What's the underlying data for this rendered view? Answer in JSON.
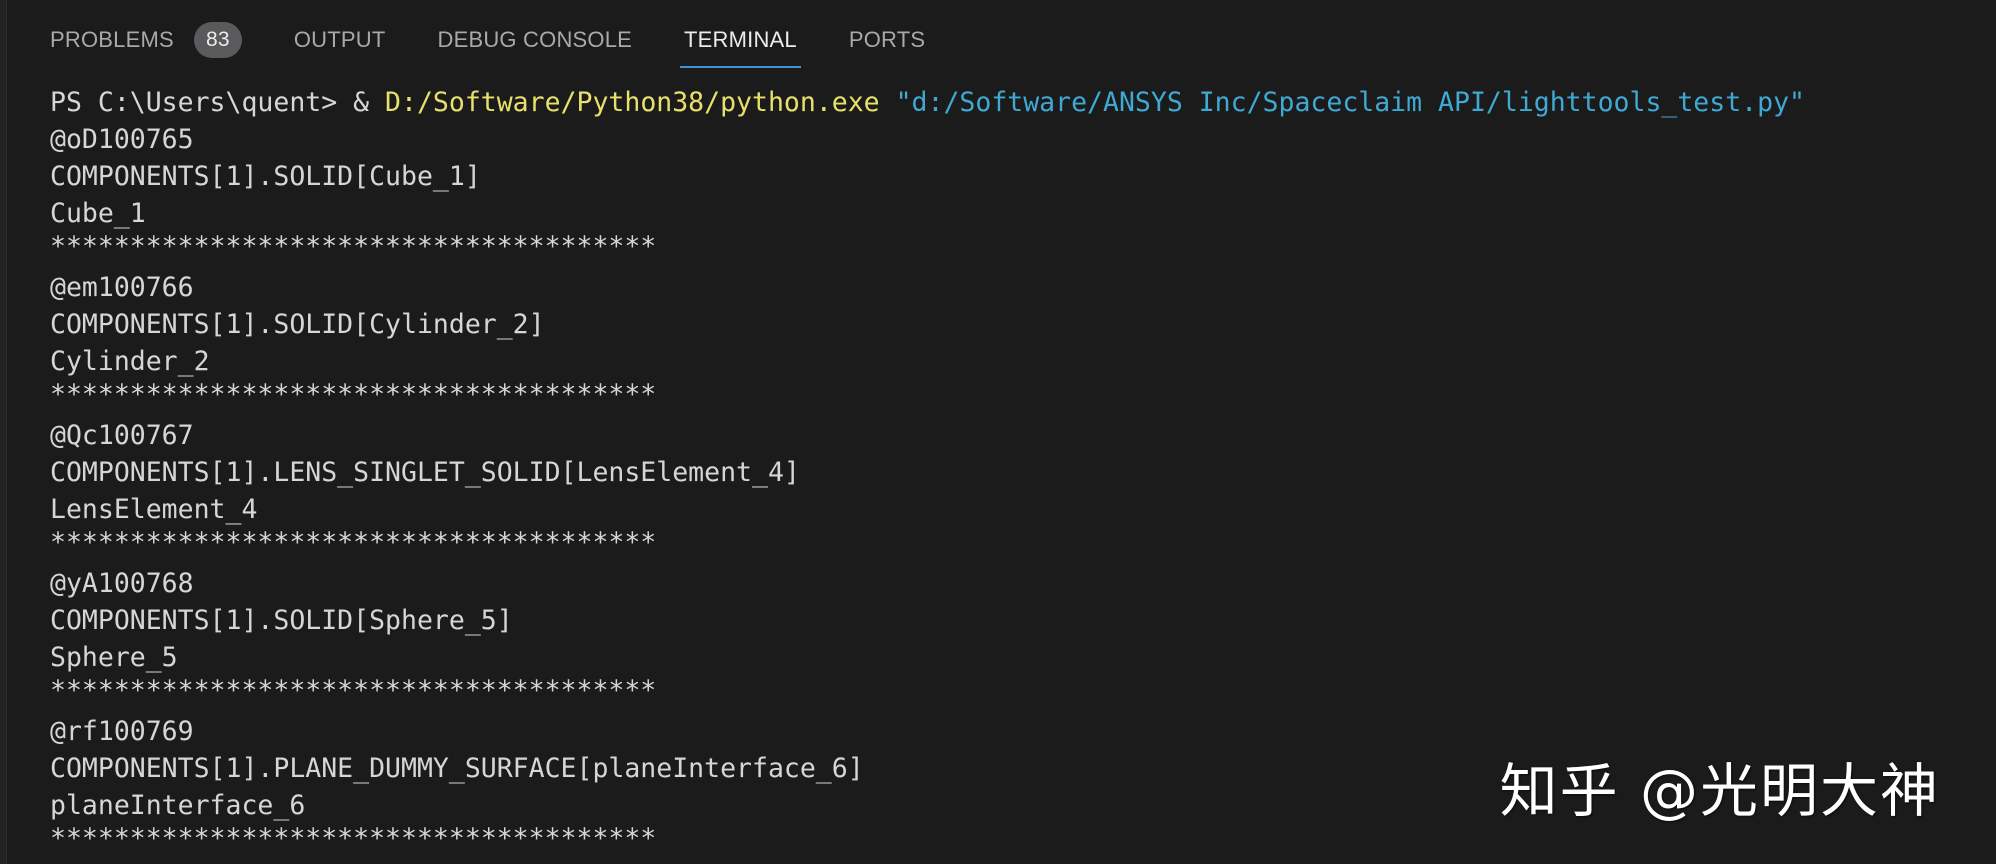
{
  "panel": {
    "tabs": [
      {
        "label": "PROBLEMS",
        "badge": "83"
      },
      {
        "label": "OUTPUT"
      },
      {
        "label": "DEBUG CONSOLE"
      },
      {
        "label": "TERMINAL"
      },
      {
        "label": "PORTS"
      }
    ],
    "active_tab": "TERMINAL"
  },
  "terminal": {
    "command": {
      "prompt": "PS C:\\Users\\quent> & ",
      "exe": "D:/Software/Python38/python.exe",
      "arg": " \"d:/Software/ANSYS Inc/Spaceclaim API/lighttools_test.py\""
    },
    "lines": [
      "@oD100765",
      "COMPONENTS[1].SOLID[Cube_1]",
      "Cube_1",
      "**************************************",
      "@em100766",
      "COMPONENTS[1].SOLID[Cylinder_2]",
      "Cylinder_2",
      "**************************************",
      "@Qc100767",
      "COMPONENTS[1].LENS_SINGLET_SOLID[LensElement_4]",
      "LensElement_4",
      "**************************************",
      "@yA100768",
      "COMPONENTS[1].SOLID[Sphere_5]",
      "Sphere_5",
      "**************************************",
      "@rf100769",
      "COMPONENTS[1].PLANE_DUMMY_SURFACE[planeInterface_6]",
      "planeInterface_6",
      "**************************************"
    ]
  },
  "watermark": "知乎 @光明大神",
  "colors": {
    "background": "#1b1b1c",
    "text": "#d6d6d6",
    "tab_inactive": "#a9a9ab",
    "tab_active": "#ececec",
    "active_underline": "#3f94d8",
    "badge_bg": "#5a5a5c",
    "exe_yellow": "#e9e06b",
    "string_blue": "#3fa9d3"
  }
}
